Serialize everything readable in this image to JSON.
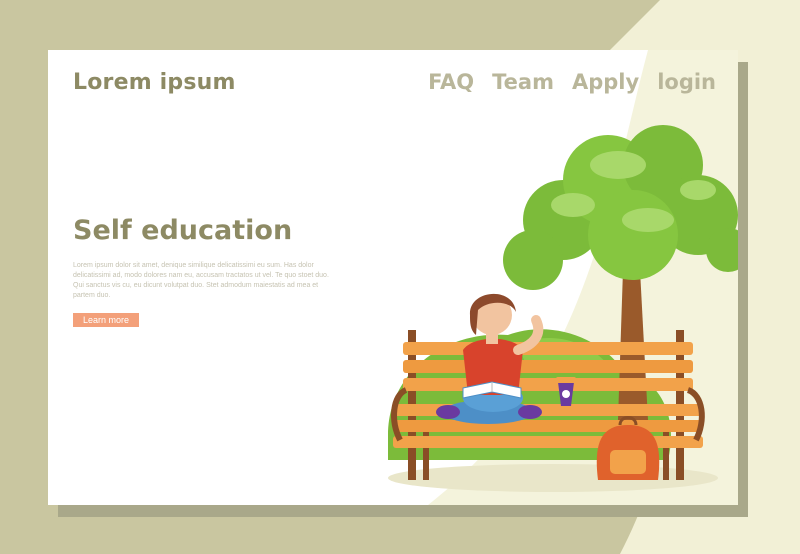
{
  "header": {
    "logo": "Lorem ipsum",
    "nav": [
      "FAQ",
      "Team",
      "Apply",
      "login"
    ]
  },
  "hero": {
    "title": "Self education",
    "body": "Lorem ipsum dolor sit amet, denique similique delicatissimi eu sum. Has dolor delicatissimi ad, modo dolores nam eu, accusam tractatos ut vel. Te quo stoet duo. Qui sanctus vis cu, eu dicunt volutpat duo. Stet admodum maiestatis ad mea et partem duo.",
    "cta_label": "Learn more"
  },
  "colors": {
    "background": "#c9c6a0",
    "accent": "#f3a07a",
    "heading": "#8d8a64",
    "nav": "#b9b69a"
  }
}
